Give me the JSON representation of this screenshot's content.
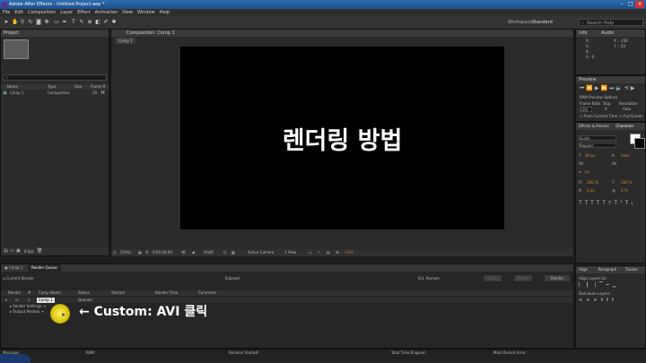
{
  "window": {
    "title": "Adobe After Effects - Untitled Project.aep *"
  },
  "menu": [
    "File",
    "Edit",
    "Composition",
    "Layer",
    "Effect",
    "Animation",
    "View",
    "Window",
    "Help"
  ],
  "toolbar": {
    "workspace_label": "Workspace:",
    "workspace_value": "Standard",
    "search_placeholder": "Search Help"
  },
  "project": {
    "header": "Project",
    "columns": [
      "Name",
      "Type",
      "Size",
      "Frame R"
    ],
    "items": [
      {
        "name": "Comp 1",
        "type": "Composition",
        "frame_rate": "30"
      }
    ],
    "bpc": "8 bpc"
  },
  "composition": {
    "tab": "Composition: Comp 1",
    "subtab": "Comp 1",
    "overlay_text": "렌더링 방법",
    "footer": {
      "zoom": "(50%)",
      "timecode": "0;00;00;00",
      "resolution": "(Half)",
      "camera": "Active Camera",
      "view": "1 View",
      "offset": "+0.0"
    }
  },
  "info": {
    "tabs": [
      "Info",
      "Audio"
    ],
    "lines": [
      "R :",
      "G :",
      "B :",
      "A : 0"
    ],
    "coords": [
      "X : -156",
      "Y : -10"
    ]
  },
  "preview": {
    "header": "Preview",
    "ram_options": "RAM Preview Options",
    "labels": [
      "Frame Rate",
      "Skip",
      "Resolution"
    ],
    "values": [
      "(30)",
      "0",
      "Auto"
    ],
    "from_current": "From Current Time",
    "full_screen": "Full Screen"
  },
  "effects": {
    "tabs": [
      "Effects & Presets",
      "Character"
    ],
    "font": "Gulim",
    "style": "Regular",
    "size": "36 px",
    "auto": "Auto",
    "percent1": "100 %",
    "percent2": "100 %",
    "px": "px",
    "zero1": "0 px",
    "zero2": "0 %"
  },
  "align": {
    "tabs": [
      "Align",
      "Paragraph",
      "Tracker"
    ],
    "align_label": "Align Layers to:",
    "distribute_label": "Distribute Layers:"
  },
  "timeline": {
    "tabs": [
      "Comp 1",
      "Render Queue"
    ],
    "current_render": "Current Render",
    "elapsed": "Elapsed:",
    "est_remain": "Est. Remain:",
    "buttons": [
      "Stop",
      "Pause",
      "Render"
    ],
    "columns": [
      "Render",
      "#",
      "Comp Name",
      "Status",
      "Started",
      "Render Time",
      "Comment"
    ],
    "item": {
      "num": "1",
      "comp": "Comp 1",
      "status": "Queued"
    },
    "render_settings": "Render Settings:",
    "output_module": "Output Module:"
  },
  "status_bar": {
    "message": "Message:",
    "ram": "RAM:",
    "renders_started": "Renders Started:",
    "total_time": "Total Time Elapsed:",
    "most_recent_error": "Most Recent Error:"
  },
  "annotation": "← Custom: AVI 클릭",
  "colors": {
    "title_blue": "#1d4f8a",
    "annotation_yellow": "#e8d320",
    "accent_orange": "#d18a2a"
  }
}
